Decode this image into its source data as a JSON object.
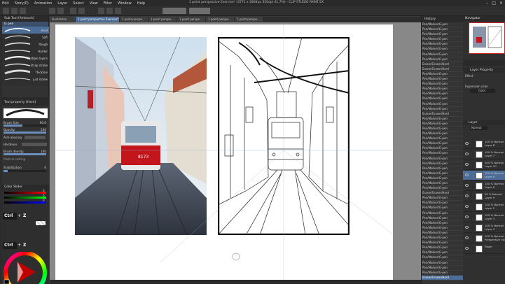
{
  "window": {
    "title": "1 point perspective Exercise* (3771 x 2864px 350dpi 41.7%)  - CLIP STUDIO PAINT EX"
  },
  "menu": [
    "Edit",
    "Story(P)",
    "Animation",
    "Layer",
    "Select",
    "View",
    "Filter",
    "Window",
    "Help"
  ],
  "tabs": [
    {
      "label": "illustration"
    },
    {
      "label": "1 point perspective Exercise*",
      "active": true
    },
    {
      "label": "1 point perspe..."
    },
    {
      "label": "1 point perspe..."
    },
    {
      "label": "1 point perspe..."
    },
    {
      "label": "1 point perspe..."
    },
    {
      "label": "1 point perspe..."
    }
  ],
  "subtool": {
    "header": "Sub Tool [Airbrush]",
    "group": "G pen",
    "brushes": [
      {
        "label": "Hard"
      },
      {
        "label": "Soft"
      },
      {
        "label": "Rough"
      },
      {
        "label": "Harder"
      },
      {
        "label": "Multiple layers"
      },
      {
        "label": "Strap stroke"
      },
      {
        "label": "Thickline"
      },
      {
        "label": "just stroke"
      }
    ]
  },
  "tool_property": {
    "header": "Tool property [Hard]",
    "brush_size": {
      "label": "Brush Size",
      "value": "90.0"
    },
    "opacity": {
      "label": "Opacity",
      "value": "100"
    },
    "anti_aliasing": {
      "label": "Anti-aliasing"
    },
    "hardness": {
      "label": "Hardness"
    },
    "brush_density": {
      "label": "Brush density",
      "value": "100"
    },
    "particle": {
      "label": "Particle setting"
    },
    "stabilization": {
      "label": "Stabilization",
      "value": "6"
    }
  },
  "color_slider": {
    "header": "Color Slider",
    "r": "0",
    "g": "0",
    "b": "0"
  },
  "shortcut_overlay": {
    "ctrl": "Ctrl",
    "plus": "+",
    "z": "Z"
  },
  "history": {
    "header": "History",
    "items": [
      "Pen/Marker/G-pen",
      "Pen/Marker/G-pen",
      "Pen/Marker/G-pen",
      "Pen/Marker/G-pen",
      "Pen/Marker/G-pen",
      "Pen/Marker/G-pen",
      "Pen/Marker/G-pen",
      "Pen/Marker/G-pen",
      "Eraser/Eraser/Hard",
      "Eraser/Eraser/Hard",
      "Pen/Marker/G-pen",
      "Pen/Marker/G-pen",
      "Pen/Marker/G-pen",
      "Pen/Marker/G-pen",
      "Pen/Marker/G-pen",
      "Pen/Marker/G-pen",
      "Pen/Marker/G-pen",
      "Pen/Marker/G-pen",
      "Eraser/Eraser/Hard",
      "Pen/Marker/G-pen",
      "Pen/Marker/G-pen",
      "Pen/Marker/G-pen",
      "Pen/Marker/G-pen",
      "Pen/Marker/G-pen",
      "Pen/Marker/G-pen",
      "Pen/Marker/G-pen",
      "Pen/Marker/G-pen",
      "Pen/Marker/G-pen",
      "Pen/Marker/G-pen",
      "Pen/Marker/G-pen",
      "Pen/Marker/G-pen",
      "Pen/Marker/G-pen",
      "Pen/Marker/G-pen",
      "Pen/Marker/G-pen",
      "Eraser/Eraser/Hard",
      "Pen/Marker/G-pen",
      "Pen/Marker/G-pen",
      "Pen/Marker/G-pen",
      "Pen/Marker/G-pen",
      "Pen/Marker/G-pen",
      "Pen/Marker/G-pen",
      "Pen/Marker/G-pen",
      "Pen/Marker/G-pen",
      "Pen/Marker/G-pen",
      "Pen/Marker/G-pen",
      "Pen/Marker/G-pen",
      "Pen/Marker/G-pen",
      "Pen/Marker/G-pen",
      "Pen/Marker/G-pen",
      "Pen/Marker/G-pen",
      "Pen/Marker/G-pen",
      "Eraser/Eraser/Hard"
    ],
    "selected_index": 51
  },
  "navigator": {
    "header": "Navigator"
  },
  "layer_property": {
    "header": "Layer Property",
    "effect": "Effect",
    "expression_color": "Expression color",
    "color_value": "Color"
  },
  "layers_panel": {
    "header": "Layer",
    "blend": "Normal",
    "layers": [
      {
        "line1": "100 % Normal",
        "line2": "Layer 8"
      },
      {
        "line1": "100 % Normal",
        "line2": "Layer 7"
      },
      {
        "line1": "100 % Normal",
        "line2": "Layer 10"
      },
      {
        "line1": "100 % Normal",
        "line2": "Layer 9",
        "selected": true
      },
      {
        "line1": "100 % Normal",
        "line2": "Layer 6"
      },
      {
        "line1": "50 % Normal",
        "line2": "Layer 5"
      },
      {
        "line1": "100 % Normal",
        "line2": "Layer 2"
      },
      {
        "line1": "100 % Normal",
        "line2": "Layer 3"
      },
      {
        "line1": "100 % Normal",
        "line2": "Layer 4"
      },
      {
        "line1": "100 % Normal",
        "line2": "Perspective ruler"
      },
      {
        "line1": "",
        "line2": "Paper"
      }
    ]
  },
  "canvas": {
    "tram_number": "8173"
  }
}
